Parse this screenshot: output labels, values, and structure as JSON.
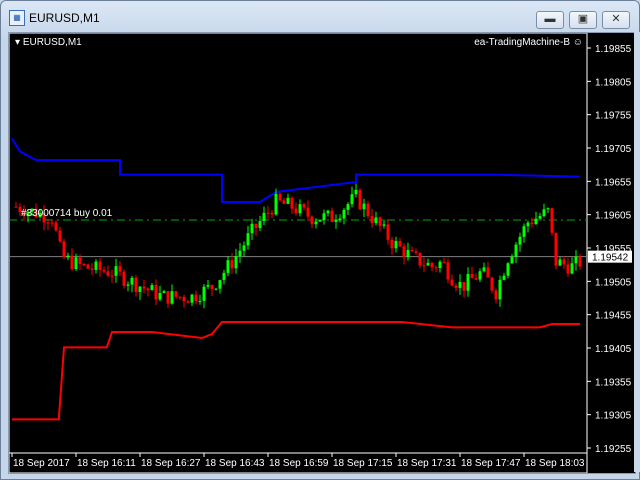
{
  "window": {
    "title": "EURUSD,M1",
    "buttons": [
      "minimize",
      "maximize",
      "close"
    ]
  },
  "chart": {
    "symbol_label": "EURUSD,M1",
    "expert": "ea-TradingMachine-B",
    "expert_icon": "smiley-icon",
    "order_label": "#33000714 buy 0.01",
    "current_price": "1.19542",
    "colors": {
      "bull": "#00ff00",
      "bear": "#ff0000",
      "upper": "#0000ff",
      "lower": "#ff0000",
      "order": "#00aa00",
      "bid": "#808080"
    }
  },
  "chart_data": {
    "type": "candlestick",
    "title": "EURUSD,M1",
    "ylim": [
      1.1923,
      1.1988
    ],
    "y_ticks": [
      "1.19855",
      "1.19805",
      "1.19755",
      "1.19705",
      "1.19655",
      "1.19605",
      "1.19555",
      "1.19505",
      "1.19455",
      "1.19405",
      "1.19355",
      "1.19305",
      "1.19255"
    ],
    "x_ticks": [
      {
        "i": 0,
        "label": "18 Sep 2017"
      },
      {
        "i": 16,
        "label": "18 Sep 16:11"
      },
      {
        "i": 32,
        "label": "18 Sep 16:27"
      },
      {
        "i": 48,
        "label": "18 Sep 16:43"
      },
      {
        "i": 64,
        "label": "18 Sep 16:59"
      },
      {
        "i": 80,
        "label": "18 Sep 17:15"
      },
      {
        "i": 96,
        "label": "18 Sep 17:31"
      },
      {
        "i": 112,
        "label": "18 Sep 17:47"
      },
      {
        "i": 128,
        "label": "18 Sep 18:03"
      }
    ],
    "price_path": [
      [
        1,
        1.19617
      ],
      [
        10,
        1.19601
      ],
      [
        12.5,
        1.19541
      ],
      [
        17.5,
        1.19527
      ],
      [
        25,
        1.19519
      ],
      [
        32.5,
        1.19497
      ],
      [
        37.5,
        1.19482
      ],
      [
        45,
        1.19482
      ],
      [
        50,
        1.19497
      ],
      [
        55,
        1.19534
      ],
      [
        60,
        1.19579
      ],
      [
        66,
        1.19624
      ],
      [
        70,
        1.19617
      ],
      [
        75,
        1.19601
      ],
      [
        80,
        1.19601
      ],
      [
        86,
        1.19631
      ],
      [
        90,
        1.19601
      ],
      [
        95,
        1.19564
      ],
      [
        100,
        1.19541
      ],
      [
        105,
        1.19527
      ],
      [
        107.5,
        1.19534
      ],
      [
        110,
        1.19511
      ],
      [
        112.5,
        1.19497
      ],
      [
        117.5,
        1.19519
      ],
      [
        121,
        1.19489
      ],
      [
        124,
        1.19541
      ],
      [
        129,
        1.19594
      ],
      [
        134,
        1.19609
      ],
      [
        136,
        1.19534
      ],
      [
        140,
        1.19527
      ],
      [
        142,
        1.19534
      ]
    ],
    "upper_band": [
      [
        0,
        1.19719
      ],
      [
        2,
        1.197
      ],
      [
        5,
        1.1969
      ],
      [
        6,
        1.19687
      ],
      [
        27,
        1.19687
      ],
      [
        27,
        1.19665
      ],
      [
        52.5,
        1.19665
      ],
      [
        52.5,
        1.19624
      ],
      [
        62,
        1.19624
      ],
      [
        66,
        1.19639
      ],
      [
        86,
        1.19654
      ],
      [
        86,
        1.19665
      ],
      [
        120,
        1.19665
      ],
      [
        142,
        1.19662
      ]
    ],
    "lower_band": [
      [
        0,
        1.19298
      ],
      [
        11.7,
        1.19298
      ],
      [
        13,
        1.19406
      ],
      [
        23.7,
        1.19406
      ],
      [
        25,
        1.19429
      ],
      [
        35,
        1.19429
      ],
      [
        47.5,
        1.1942
      ],
      [
        50,
        1.19426
      ],
      [
        52.5,
        1.19444
      ],
      [
        97.5,
        1.19444
      ],
      [
        110,
        1.19436
      ],
      [
        132,
        1.19436
      ],
      [
        135,
        1.19441
      ],
      [
        142,
        1.19441
      ]
    ],
    "order_price": 1.19597,
    "bid": 1.19542
  }
}
